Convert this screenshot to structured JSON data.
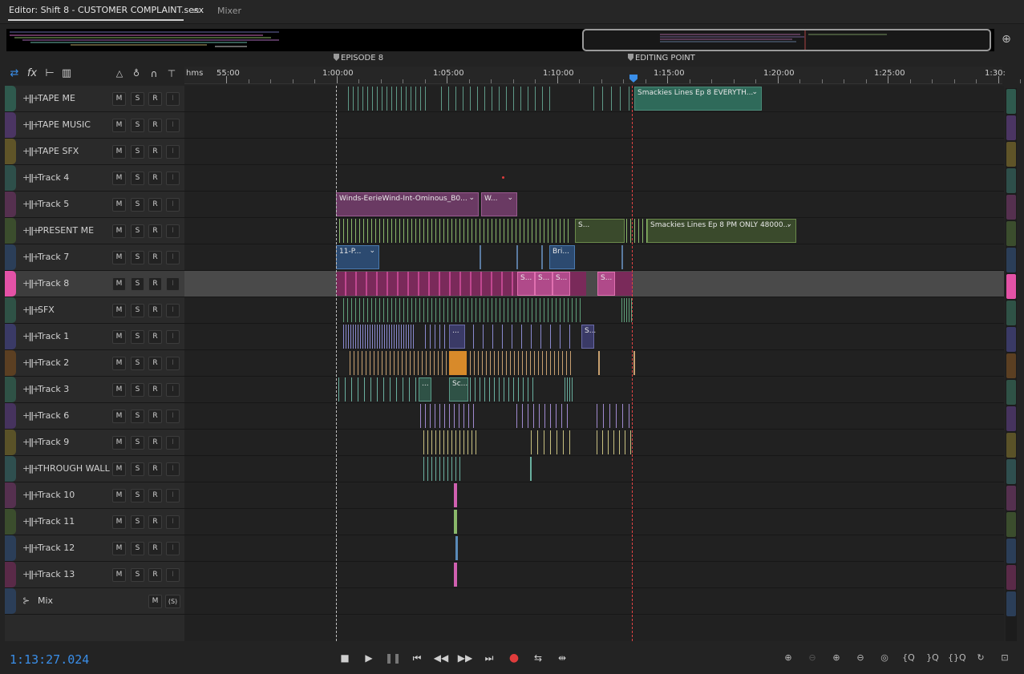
{
  "tabs": {
    "editor_label": "Editor: Shift 8 - CUSTOMER COMPLAINT.sesx",
    "menu_icon": "≡",
    "mixer_label": "Mixer"
  },
  "ruler": {
    "unit": "hms",
    "labels": [
      "55:00",
      "1:00:00",
      "1:05:00",
      "1:10:00",
      "1:15:00",
      "1:20:00",
      "1:25:00",
      "1:30:"
    ]
  },
  "markers": [
    {
      "name": "EPISODE 8"
    },
    {
      "name": "EDITING POINT"
    }
  ],
  "tracks": [
    {
      "name": "TAPE ME",
      "color": "#2f5a4e",
      "type": "audio"
    },
    {
      "name": "TAPE MUSIC",
      "color": "#4b3563",
      "type": "audio"
    },
    {
      "name": "TAPE SFX",
      "color": "#5f5428",
      "type": "audio"
    },
    {
      "name": "Track 4",
      "color": "#2e4f4a",
      "type": "audio"
    },
    {
      "name": "Track 5",
      "color": "#55304f",
      "type": "audio"
    },
    {
      "name": "PRESENT ME",
      "color": "#3b4d2d",
      "type": "audio"
    },
    {
      "name": "Track 7",
      "color": "#2b3e58",
      "type": "audio"
    },
    {
      "name": "Track 8",
      "color": "#e352a6",
      "type": "audio",
      "selected": true
    },
    {
      "name": "SFX",
      "color": "#2f5246",
      "type": "audio"
    },
    {
      "name": "Track 1",
      "color": "#3a3a66",
      "type": "audio"
    },
    {
      "name": "Track 2",
      "color": "#5b3f22",
      "type": "audio"
    },
    {
      "name": "Track 3",
      "color": "#2f5246",
      "type": "audio"
    },
    {
      "name": "Track 6",
      "color": "#46335e",
      "type": "audio"
    },
    {
      "name": "Track 9",
      "color": "#5a5228",
      "type": "audio"
    },
    {
      "name": "THROUGH WALL",
      "color": "#2f4f4f",
      "type": "audio"
    },
    {
      "name": "Track 10",
      "color": "#55304f",
      "type": "audio"
    },
    {
      "name": "Track 11",
      "color": "#3b4d2d",
      "type": "audio"
    },
    {
      "name": "Track 12",
      "color": "#2b3e58",
      "type": "audio"
    },
    {
      "name": "Track 13",
      "color": "#5a2a48",
      "type": "audio"
    },
    {
      "name": "Mix",
      "color": "#2b3e58",
      "type": "mix"
    }
  ],
  "track_buttons": {
    "mute": "M",
    "solo": "S",
    "record": "R",
    "input": "I",
    "mix_solo": "(S)"
  },
  "clips": {
    "tape_me_label": "Smackies Lines Ep 8 EVERYTH...",
    "track5_label1": "Winds-EerieWind-Int-Ominous_B0...",
    "track5_label2": "W...",
    "present_me_label": "Smackies Lines Ep 8 PM ONLY 48000...",
    "present_me_small": "S...",
    "track7_label1": "11-P...",
    "track7_label2": "Bri...",
    "track8_s1": "S...",
    "track8_s2": "S...",
    "track8_s3": "S...",
    "track8_s4": "S...",
    "track1_small1": "...",
    "track1_small2": "S...",
    "track3_small1": "...",
    "track3_small2": "Sc..."
  },
  "transport": {
    "timecode": "1:13:27.024"
  },
  "icons": {
    "stop": "stop-icon",
    "play": "play-icon",
    "pause": "pause-icon",
    "to_start": "skip-start-icon",
    "rewind": "rewind-icon",
    "ffwd": "fast-forward-icon",
    "to_end": "skip-end-icon",
    "record": "record-icon",
    "loop": "loop-icon",
    "skip": "skip-selection-icon"
  },
  "colors": {
    "accent": "#3a8ee8",
    "record": "#e03c3c",
    "playhead": "#e24343"
  }
}
